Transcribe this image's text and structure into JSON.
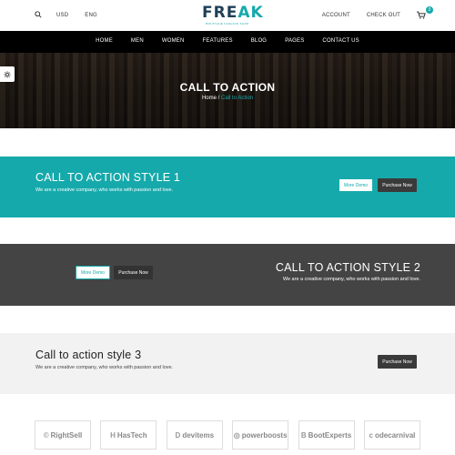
{
  "topbar": {
    "currency": "USD",
    "language": "ENG",
    "account": "ACCOUNT",
    "checkout": "CHECK OUT",
    "cart_count": "0"
  },
  "logo": {
    "word_a": "FRE",
    "word_b": "AK",
    "tagline": "BOUTIQUE FASHION SHOP"
  },
  "nav": {
    "items": [
      "HOME",
      "MEN",
      "WOMEN",
      "FEATURES",
      "BLOG",
      "PAGES",
      "CONTACT US"
    ]
  },
  "hero": {
    "title": "CALL TO ACTION",
    "breadcrumb_home": "Home",
    "breadcrumb_sep": " / ",
    "breadcrumb_current": "Call to Action"
  },
  "cta1": {
    "heading": "CALL TO ACTION STYLE 1",
    "text": "We are a creative company, who works with passion and love.",
    "more_demo": "More Demo",
    "purchase": "Purchase Now"
  },
  "cta2": {
    "heading": "CALL TO ACTION STYLE 2",
    "text": "We are a creative company, who works with passion and love.",
    "more_demo": "More Demo",
    "purchase": "Purchase Now"
  },
  "cta3": {
    "heading": "Call to action style 3",
    "text": "We are a creative company, who works with passion and love.",
    "purchase": "Purchase Now"
  },
  "brands": [
    {
      "mark": "©",
      "name": "RightSell"
    },
    {
      "mark": "H",
      "name": "HasTech"
    },
    {
      "mark": "D",
      "name": "devitems"
    },
    {
      "mark": "◎",
      "name": "powerboosts"
    },
    {
      "mark": "B",
      "name": "BootExperts"
    },
    {
      "mark": "c",
      "name": "odecarnival"
    }
  ],
  "colors": {
    "accent": "#16a9ab",
    "dark_band": "#444444",
    "light_band": "#f2f2f2",
    "nav_bg": "#000000"
  },
  "icons": [
    "search-icon",
    "cart-icon",
    "gear-icon"
  ]
}
